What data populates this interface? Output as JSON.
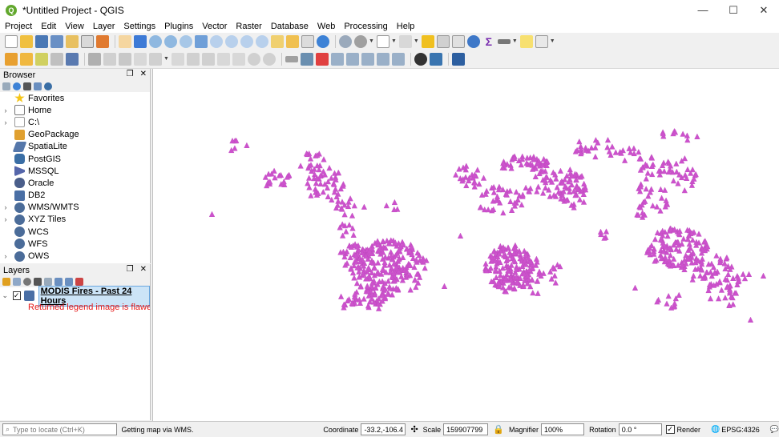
{
  "window": {
    "title": "*Untitled Project - QGIS",
    "controls": [
      "—",
      "☐",
      "✕"
    ]
  },
  "menu": [
    "Project",
    "Edit",
    "View",
    "Layer",
    "Settings",
    "Plugins",
    "Vector",
    "Raster",
    "Database",
    "Web",
    "Processing",
    "Help"
  ],
  "colors": {
    "accent": "#cc52cc",
    "selection": "#cce4f7",
    "warning": "#e51a1a"
  },
  "browser": {
    "title": "Browser",
    "items": [
      {
        "label": "Favorites",
        "icon": "star-icon",
        "color": "#f5c518",
        "expander": ""
      },
      {
        "label": "Home",
        "icon": "home-icon",
        "color": "#888888",
        "expander": "›"
      },
      {
        "label": "C:\\",
        "icon": "drive-icon",
        "color": "#bbbbbb",
        "expander": "›"
      },
      {
        "label": "GeoPackage",
        "icon": "geopackage-icon",
        "color": "#e0a030",
        "expander": ""
      },
      {
        "label": "SpatiaLite",
        "icon": "spatialite-icon",
        "color": "#5577aa",
        "expander": ""
      },
      {
        "label": "PostGIS",
        "icon": "postgis-icon",
        "color": "#3a6ea5",
        "expander": ""
      },
      {
        "label": "MSSQL",
        "icon": "mssql-icon",
        "color": "#5566aa",
        "expander": ""
      },
      {
        "label": "Oracle",
        "icon": "oracle-icon",
        "color": "#4a5e8a",
        "expander": ""
      },
      {
        "label": "DB2",
        "icon": "db2-icon",
        "color": "#4a6fa5",
        "expander": ""
      },
      {
        "label": "WMS/WMTS",
        "icon": "globe-icon",
        "color": "#4b6c99",
        "expander": "›"
      },
      {
        "label": "XYZ Tiles",
        "icon": "globe-icon",
        "color": "#4b6c99",
        "expander": "›"
      },
      {
        "label": "WCS",
        "icon": "globe-icon",
        "color": "#4b6c99",
        "expander": ""
      },
      {
        "label": "WFS",
        "icon": "globe-icon",
        "color": "#4b6c99",
        "expander": ""
      },
      {
        "label": "OWS",
        "icon": "globe-icon",
        "color": "#4b6c99",
        "expander": "›"
      }
    ]
  },
  "layers": {
    "title": "Layers",
    "layer": {
      "name": "MODIS Fires - Past 24 Hours",
      "checked": "✓",
      "expander": "⌄"
    },
    "warning": "Returned legend image is flawed"
  },
  "statusbar": {
    "locate_placeholder": "Type to locate (Ctrl+K)",
    "message": "Getting map via WMS.",
    "coordinate_label": "Coordinate",
    "coordinate": "-33.2,-106.4",
    "scale_label": "Scale",
    "scale": "159907799",
    "magnifier_label": "Magnifier",
    "magnifier": "100%",
    "rotation_label": "Rotation",
    "rotation": "0.0 °",
    "render_label": "Render",
    "crs": "EPSG:4326"
  }
}
